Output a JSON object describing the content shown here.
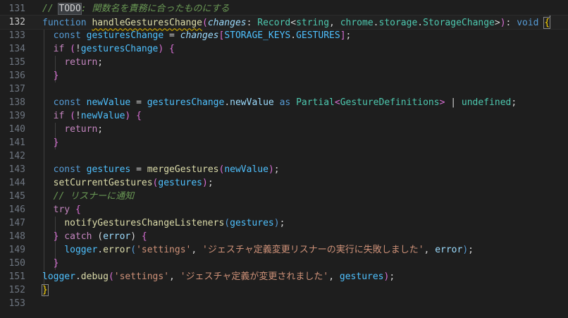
{
  "editor": {
    "lines": [
      {
        "n": "131",
        "tokens": [
          [
            "// ",
            "#6a9955",
            "i"
          ],
          [
            "TODO",
            "#d4d4d4",
            "todo"
          ],
          [
            ": 関数名を責務に合ったものにする",
            "#6a9955",
            "i"
          ]
        ]
      },
      {
        "n": "132",
        "current": true,
        "tokens": [
          [
            "function ",
            "#569cd6"
          ],
          [
            "handleGesturesChange",
            "#dcdcaa",
            "sq"
          ],
          [
            "(",
            "#da70d6"
          ],
          [
            "changes",
            "#9cdcfe",
            "i"
          ],
          [
            ": ",
            "#d4d4d4"
          ],
          [
            "Record",
            "#4ec9b0"
          ],
          [
            "<",
            "#d4d4d4"
          ],
          [
            "string",
            "#4ec9b0"
          ],
          [
            ", ",
            "#d4d4d4"
          ],
          [
            "chrome",
            "#4ec9b0"
          ],
          [
            ".",
            "#d4d4d4"
          ],
          [
            "storage",
            "#4ec9b0"
          ],
          [
            ".",
            "#d4d4d4"
          ],
          [
            "StorageChange",
            "#4ec9b0"
          ],
          [
            ">",
            "#d4d4d4"
          ],
          [
            ")",
            "#da70d6"
          ],
          [
            ": ",
            "#d4d4d4"
          ],
          [
            "void",
            "#569cd6"
          ],
          [
            " ",
            "#d4d4d4"
          ],
          [
            "{",
            "#ffd700",
            "bm"
          ]
        ]
      },
      {
        "n": "133",
        "tokens": [
          [
            "  ",
            "#d4d4d4"
          ],
          [
            "const ",
            "#569cd6"
          ],
          [
            "gesturesChange",
            "#4fc1ff"
          ],
          [
            " = ",
            "#d4d4d4"
          ],
          [
            "changes",
            "#9cdcfe",
            "i"
          ],
          [
            "[",
            "#da70d6"
          ],
          [
            "STORAGE_KEYS",
            "#4fc1ff"
          ],
          [
            ".",
            "#d4d4d4"
          ],
          [
            "GESTURES",
            "#4fc1ff"
          ],
          [
            "]",
            "#da70d6"
          ],
          [
            ";",
            "#d4d4d4"
          ]
        ]
      },
      {
        "n": "134",
        "tokens": [
          [
            "  ",
            "#d4d4d4"
          ],
          [
            "if",
            "#c586c0"
          ],
          [
            " ",
            "#d4d4d4"
          ],
          [
            "(",
            "#da70d6"
          ],
          [
            "!",
            "#d4d4d4"
          ],
          [
            "gesturesChange",
            "#4fc1ff"
          ],
          [
            ")",
            "#da70d6"
          ],
          [
            " ",
            "#d4d4d4"
          ],
          [
            "{",
            "#da70d6"
          ]
        ]
      },
      {
        "n": "135",
        "tokens": [
          [
            "    ",
            "#d4d4d4"
          ],
          [
            "return",
            "#c586c0"
          ],
          [
            ";",
            "#d4d4d4"
          ]
        ]
      },
      {
        "n": "136",
        "tokens": [
          [
            "  ",
            "#d4d4d4"
          ],
          [
            "}",
            "#da70d6"
          ]
        ]
      },
      {
        "n": "137",
        "tokens": []
      },
      {
        "n": "138",
        "tokens": [
          [
            "  ",
            "#d4d4d4"
          ],
          [
            "const ",
            "#569cd6"
          ],
          [
            "newValue",
            "#4fc1ff"
          ],
          [
            " = ",
            "#d4d4d4"
          ],
          [
            "gesturesChange",
            "#4fc1ff"
          ],
          [
            ".",
            "#d4d4d4"
          ],
          [
            "newValue",
            "#9cdcfe"
          ],
          [
            " as ",
            "#569cd6"
          ],
          [
            "Partial",
            "#4ec9b0"
          ],
          [
            "<",
            "#da70d6"
          ],
          [
            "GestureDefinitions",
            "#4ec9b0"
          ],
          [
            ">",
            "#da70d6"
          ],
          [
            " | ",
            "#d4d4d4"
          ],
          [
            "undefined",
            "#4ec9b0"
          ],
          [
            ";",
            "#d4d4d4"
          ]
        ]
      },
      {
        "n": "139",
        "tokens": [
          [
            "  ",
            "#d4d4d4"
          ],
          [
            "if",
            "#c586c0"
          ],
          [
            " ",
            "#d4d4d4"
          ],
          [
            "(",
            "#da70d6"
          ],
          [
            "!",
            "#d4d4d4"
          ],
          [
            "newValue",
            "#4fc1ff"
          ],
          [
            ")",
            "#da70d6"
          ],
          [
            " ",
            "#d4d4d4"
          ],
          [
            "{",
            "#da70d6"
          ]
        ]
      },
      {
        "n": "140",
        "tokens": [
          [
            "    ",
            "#d4d4d4"
          ],
          [
            "return",
            "#c586c0"
          ],
          [
            ";",
            "#d4d4d4"
          ]
        ]
      },
      {
        "n": "141",
        "tokens": [
          [
            "  ",
            "#d4d4d4"
          ],
          [
            "}",
            "#da70d6"
          ]
        ]
      },
      {
        "n": "142",
        "tokens": []
      },
      {
        "n": "143",
        "tokens": [
          [
            "  ",
            "#d4d4d4"
          ],
          [
            "const ",
            "#569cd6"
          ],
          [
            "gestures",
            "#4fc1ff"
          ],
          [
            " = ",
            "#d4d4d4"
          ],
          [
            "mergeGestures",
            "#dcdcaa"
          ],
          [
            "(",
            "#da70d6"
          ],
          [
            "newValue",
            "#4fc1ff"
          ],
          [
            ")",
            "#da70d6"
          ],
          [
            ";",
            "#d4d4d4"
          ]
        ]
      },
      {
        "n": "144",
        "tokens": [
          [
            "  ",
            "#d4d4d4"
          ],
          [
            "setCurrentGestures",
            "#dcdcaa"
          ],
          [
            "(",
            "#da70d6"
          ],
          [
            "gestures",
            "#4fc1ff"
          ],
          [
            ")",
            "#da70d6"
          ],
          [
            ";",
            "#d4d4d4"
          ]
        ]
      },
      {
        "n": "145",
        "tokens": [
          [
            "  ",
            "#d4d4d4"
          ],
          [
            "// リスナーに通知",
            "#6a9955",
            "i"
          ]
        ]
      },
      {
        "n": "146",
        "tokens": [
          [
            "  ",
            "#d4d4d4"
          ],
          [
            "try",
            "#c586c0"
          ],
          [
            " ",
            "#d4d4d4"
          ],
          [
            "{",
            "#da70d6"
          ]
        ]
      },
      {
        "n": "147",
        "tokens": [
          [
            "    ",
            "#d4d4d4"
          ],
          [
            "notifyGesturesChangeListeners",
            "#dcdcaa"
          ],
          [
            "(",
            "#569cd6"
          ],
          [
            "gestures",
            "#4fc1ff"
          ],
          [
            ")",
            "#569cd6"
          ],
          [
            ";",
            "#d4d4d4"
          ]
        ]
      },
      {
        "n": "148",
        "tokens": [
          [
            "  ",
            "#d4d4d4"
          ],
          [
            "}",
            "#da70d6"
          ],
          [
            " catch ",
            "#c586c0"
          ],
          [
            "(",
            "#d4d4d4"
          ],
          [
            "error",
            "#9cdcfe"
          ],
          [
            ")",
            "#d4d4d4"
          ],
          [
            " ",
            "#d4d4d4"
          ],
          [
            "{",
            "#da70d6"
          ]
        ]
      },
      {
        "n": "149",
        "tokens": [
          [
            "    ",
            "#d4d4d4"
          ],
          [
            "logger",
            "#4fc1ff"
          ],
          [
            ".",
            "#d4d4d4"
          ],
          [
            "error",
            "#dcdcaa"
          ],
          [
            "(",
            "#569cd6"
          ],
          [
            "'settings'",
            "#ce9178"
          ],
          [
            ", ",
            "#d4d4d4"
          ],
          [
            "'ジェスチャ定義変更リスナーの実行に失敗しました'",
            "#ce9178"
          ],
          [
            ", ",
            "#d4d4d4"
          ],
          [
            "error",
            "#9cdcfe"
          ],
          [
            ")",
            "#569cd6"
          ],
          [
            ";",
            "#d4d4d4"
          ]
        ]
      },
      {
        "n": "150",
        "tokens": [
          [
            "  ",
            "#d4d4d4"
          ],
          [
            "}",
            "#da70d6"
          ]
        ]
      },
      {
        "n": "151",
        "tokens": [
          [
            "logger",
            "#4fc1ff"
          ],
          [
            ".",
            "#d4d4d4"
          ],
          [
            "debug",
            "#dcdcaa"
          ],
          [
            "(",
            "#da70d6"
          ],
          [
            "'settings'",
            "#ce9178"
          ],
          [
            ", ",
            "#d4d4d4"
          ],
          [
            "'ジェスチャ定義が変更されました'",
            "#ce9178"
          ],
          [
            ", ",
            "#d4d4d4"
          ],
          [
            "gestures",
            "#4fc1ff"
          ],
          [
            ")",
            "#da70d6"
          ],
          [
            ";",
            "#d4d4d4"
          ]
        ]
      },
      {
        "n": "152",
        "tokens": [
          [
            "}",
            "#ffd700",
            "bm"
          ]
        ]
      },
      {
        "n": "153",
        "tokens": []
      }
    ]
  }
}
